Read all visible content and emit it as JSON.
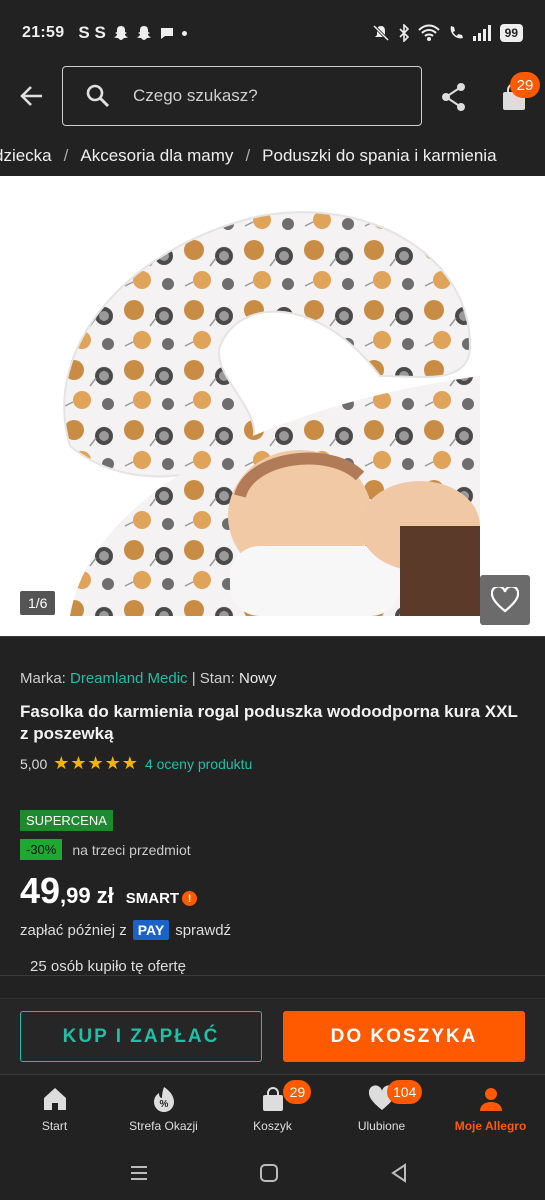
{
  "status_bar": {
    "time": "21:59",
    "notifications": "S S",
    "battery": "99",
    "icons": [
      "snapchat-icon",
      "snapchat-icon",
      "chat-icon",
      "dot-icon",
      "mute-icon",
      "bluetooth-icon",
      "wifi-icon",
      "call-icon",
      "signal-icon",
      "battery-icon"
    ]
  },
  "header": {
    "search_placeholder": "Czego szukasz?",
    "cart_badge": "29"
  },
  "breadcrumb": [
    "dziecka",
    "Akcesoria dla mamy",
    "Poduszki do spania i karmienia"
  ],
  "gallery": {
    "counter": "1/6"
  },
  "product": {
    "brand_label": "Marka:",
    "brand": "Dreamland Medic",
    "condition_label": "| Stan:",
    "condition": "Nowy",
    "title": "Fasolka do karmienia rogal poduszka wodoodporna kura XXL z poszewką",
    "rating_value": "5,00",
    "stars": "★★★★★",
    "ratings_link": "4 oceny produktu",
    "supercena": "SUPERCENA",
    "discount": "-30%",
    "discount_text": "na trzeci przedmiot",
    "price_int": "49",
    "price_dec": ",99",
    "currency": "zł",
    "smart": "SMART",
    "pay_prefix": "zapłać później z",
    "pay_logo": "PAY",
    "pay_suffix": "sprawdź",
    "bought": "25 osób kupiło tę ofertę"
  },
  "actions": {
    "buy": "KUP I ZAPŁAĆ",
    "cart": "DO KOSZYKA"
  },
  "bottom_nav": [
    {
      "label": "Start",
      "badge": ""
    },
    {
      "label": "Strefa Okazji",
      "badge": ""
    },
    {
      "label": "Koszyk",
      "badge": "29"
    },
    {
      "label": "Ulubione",
      "badge": "104"
    },
    {
      "label": "Moje Allegro",
      "badge": ""
    }
  ],
  "colors": {
    "accent": "#ff5a00",
    "link": "#1fbfa8",
    "background": "#222222"
  }
}
